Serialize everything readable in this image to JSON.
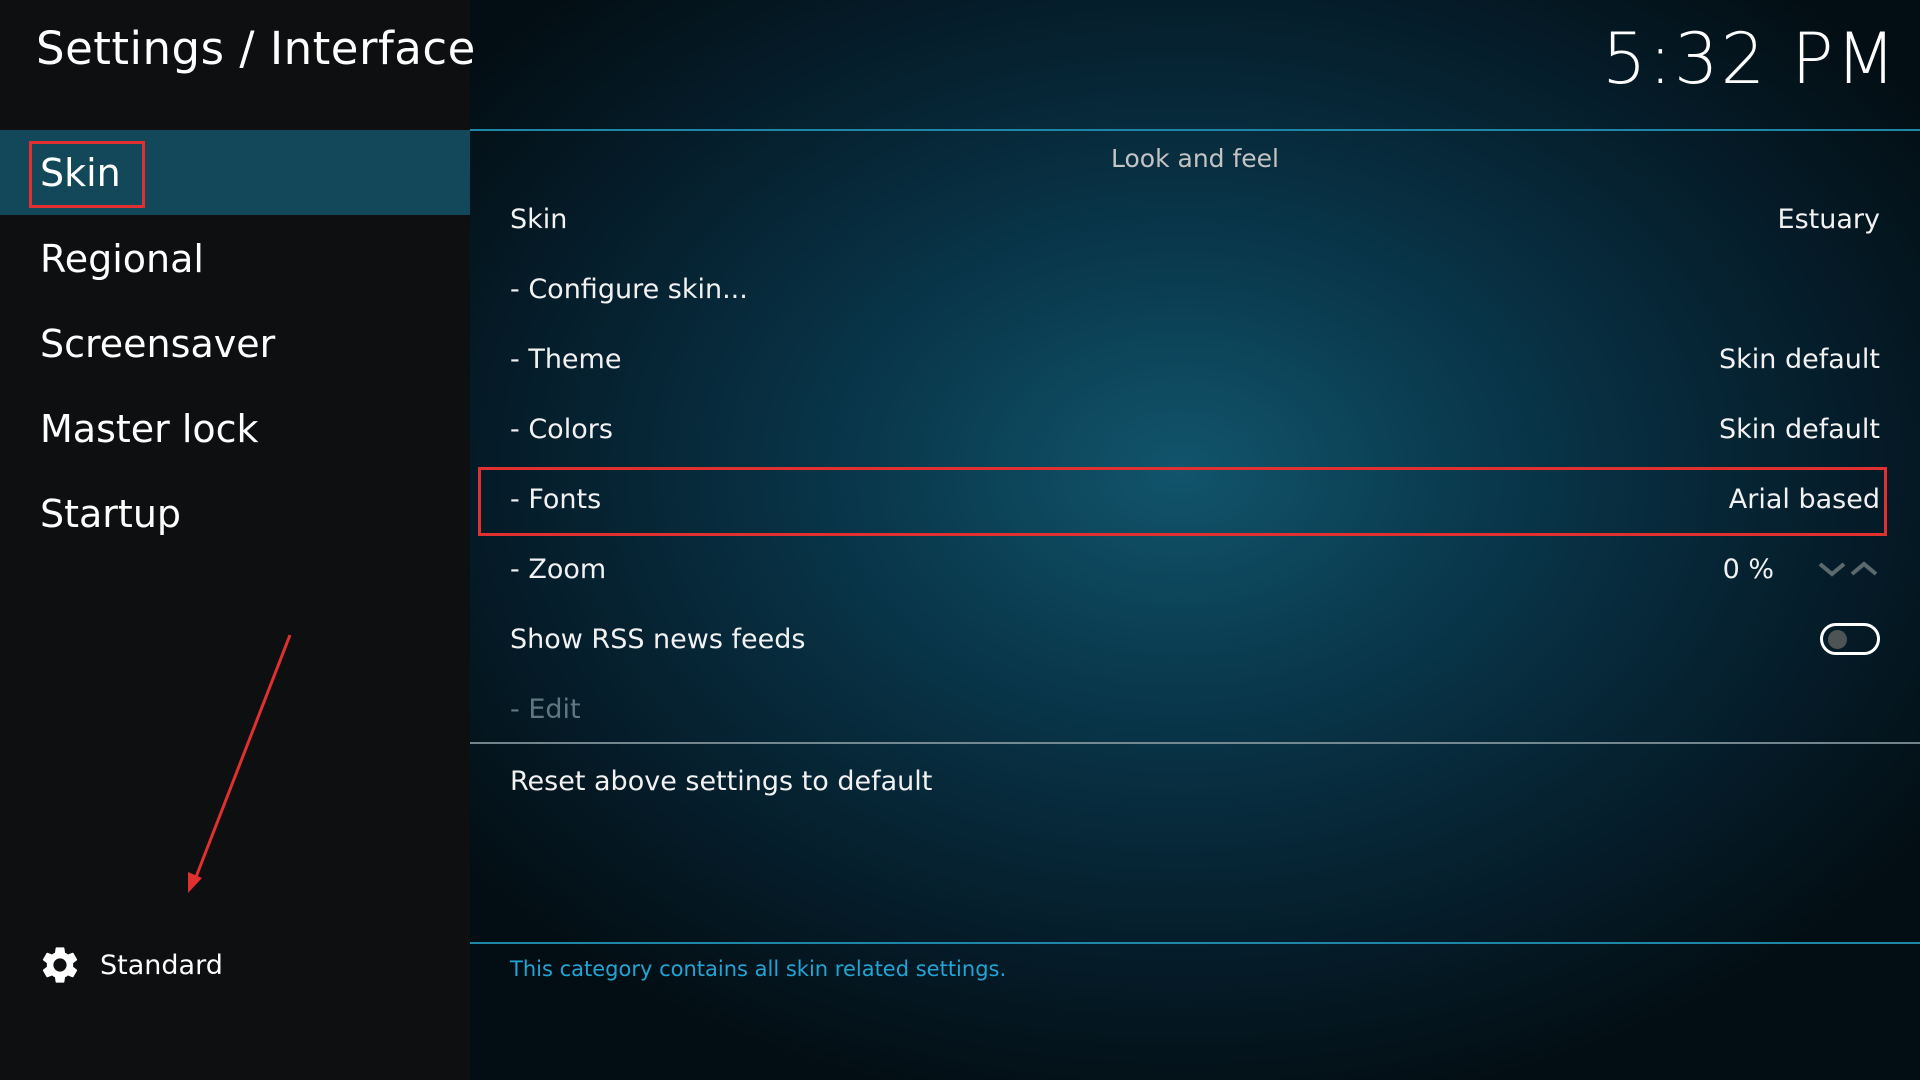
{
  "header": {
    "title": "Settings / Interface",
    "clock": "5:32 PM"
  },
  "sidebar": {
    "items": [
      {
        "label": "Skin",
        "active": true
      },
      {
        "label": "Regional"
      },
      {
        "label": "Screensaver"
      },
      {
        "label": "Master lock"
      },
      {
        "label": "Startup"
      }
    ],
    "level": {
      "icon": "gear-icon",
      "label": "Standard"
    }
  },
  "main": {
    "group_title": "Look and feel",
    "rows": {
      "skin": {
        "label": "Skin",
        "value": "Estuary"
      },
      "configure": {
        "label": "- Configure skin..."
      },
      "theme": {
        "label": "- Theme",
        "value": "Skin default"
      },
      "colors": {
        "label": "- Colors",
        "value": "Skin default"
      },
      "fonts": {
        "label": "- Fonts",
        "value": "Arial based"
      },
      "zoom": {
        "label": "- Zoom",
        "value": "0 %"
      },
      "rss": {
        "label": "Show RSS news feeds",
        "enabled": false
      },
      "edit": {
        "label": "- Edit",
        "disabled": true
      },
      "reset": {
        "label": "Reset above settings to default"
      }
    },
    "description": "This category contains all skin related settings."
  },
  "annotations": {
    "highlight_color": "#e03030",
    "highlighted": [
      "sidebar-item-skin",
      "setting-row-fonts"
    ]
  },
  "colors": {
    "accent": "#1e86a6",
    "sidebar_active": "#12485a",
    "description_text": "#22a5d6"
  }
}
